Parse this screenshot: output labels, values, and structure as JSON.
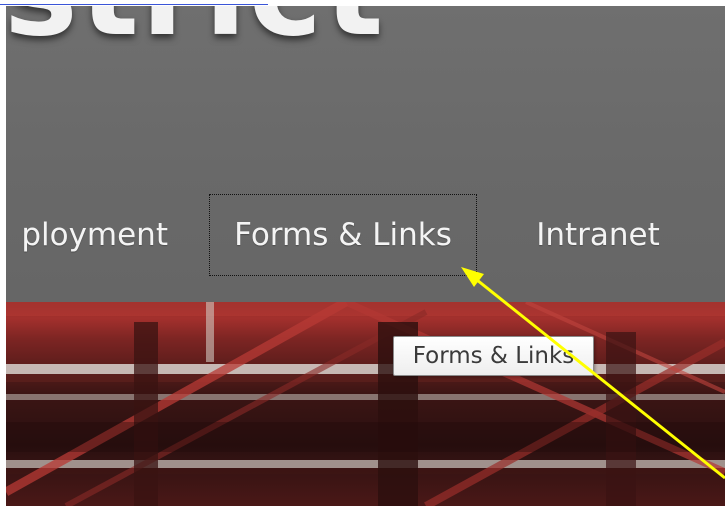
{
  "header": {
    "top_link_text": "",
    "site_title": "strict"
  },
  "nav": {
    "items": [
      {
        "label": "ployment"
      },
      {
        "label": "Forms & Links"
      },
      {
        "label": "Intranet"
      }
    ]
  },
  "tooltip": {
    "text": "Forms & Links"
  },
  "annotation": {
    "arrow_color": "#ffff00"
  },
  "colors": {
    "banner": "#6b6b6b",
    "nav_text": "#f4f4f4",
    "photo_red": "#a3302d",
    "link": "#3a55d8"
  }
}
